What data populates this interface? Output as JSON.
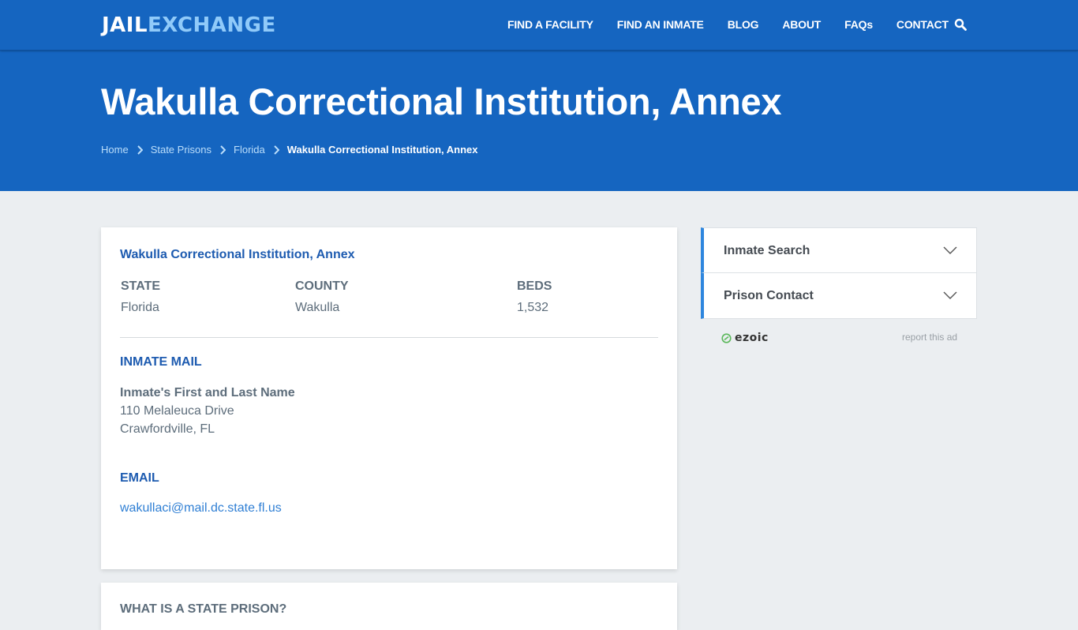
{
  "brand": {
    "part1": "JAIL",
    "part2": "EXCHANGE"
  },
  "nav": {
    "items": [
      "FIND A FACILITY",
      "FIND AN INMATE",
      "BLOG",
      "ABOUT",
      "FAQs",
      "CONTACT"
    ],
    "search_icon": "search-icon"
  },
  "hero": {
    "title": "Wakulla Correctional Institution, Annex",
    "breadcrumbs": [
      "Home",
      "State Prisons",
      "Florida",
      "Wakulla Correctional Institution, Annex"
    ]
  },
  "facility": {
    "title": "Wakulla Correctional Institution, Annex",
    "fields": [
      {
        "label": "STATE",
        "value": "Florida"
      },
      {
        "label": "COUNTY",
        "value": "Wakulla"
      },
      {
        "label": "BEDS",
        "value": "1,532"
      }
    ],
    "mail": {
      "heading": "INMATE MAIL",
      "name_line": "Inmate's First and Last Name",
      "street": "110 Melaleuca Drive",
      "city": "Crawfordville, FL"
    },
    "email": {
      "heading": "EMAIL",
      "address": "wakullaci@mail.dc.state.fl.us"
    }
  },
  "next_section": {
    "heading": "WHAT IS A STATE PRISON?"
  },
  "sidebar": {
    "accordions": [
      "Inmate Search",
      "Prison Contact"
    ],
    "ad_brand": "ezoic",
    "report_ad": "report this ad"
  },
  "colors": {
    "brand_blue": "#1565c0",
    "accent_blue": "#1d5bb0",
    "link_blue": "#2f7fd4",
    "logo_light": "#90caf9"
  }
}
